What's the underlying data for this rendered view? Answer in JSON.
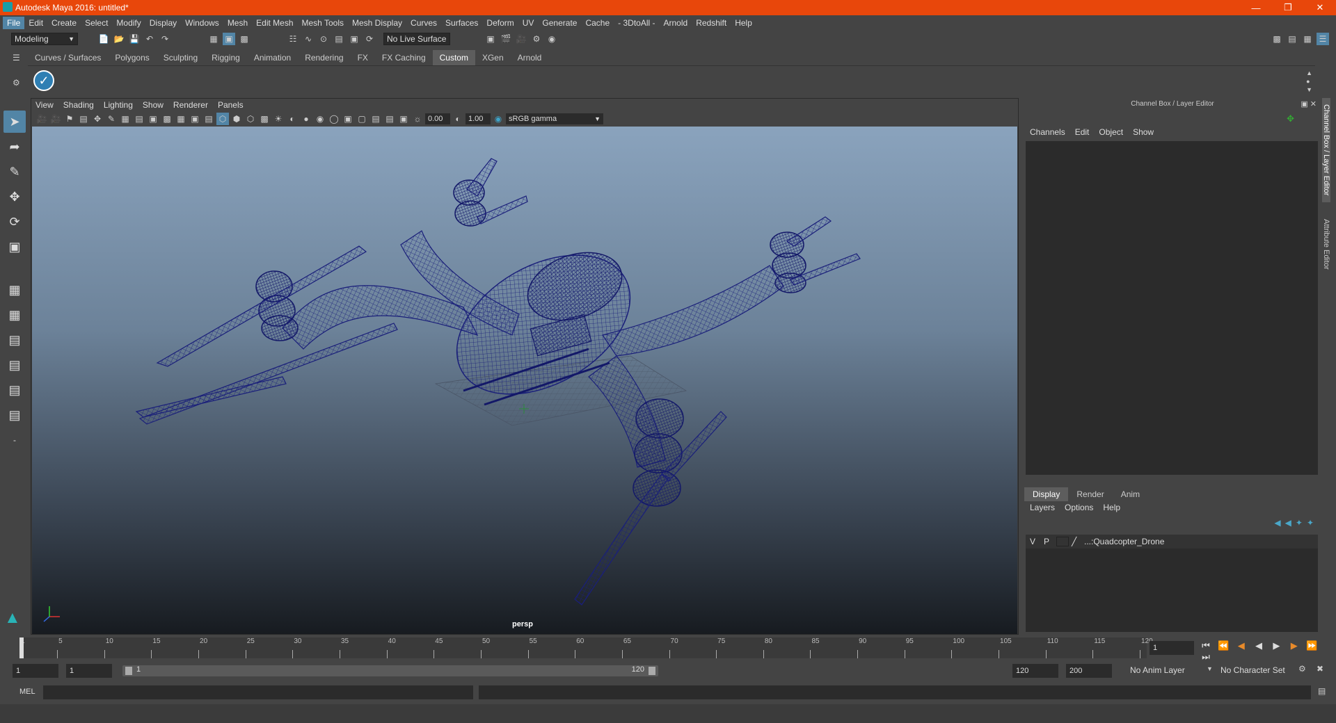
{
  "window": {
    "title": "Autodesk Maya 2016: untitled*"
  },
  "menubar": {
    "items": [
      "File",
      "Edit",
      "Create",
      "Select",
      "Modify",
      "Display",
      "Windows",
      "Mesh",
      "Edit Mesh",
      "Mesh Tools",
      "Mesh Display",
      "Curves",
      "Surfaces",
      "Deform",
      "UV",
      "Generate",
      "Cache",
      "- 3DtoAll -",
      "Arnold",
      "Redshift",
      "Help"
    ]
  },
  "statusline": {
    "menuset": "Modeling",
    "live_surface": "No Live Surface"
  },
  "shelf": {
    "tabs": [
      "Curves / Surfaces",
      "Polygons",
      "Sculpting",
      "Rigging",
      "Animation",
      "Rendering",
      "FX",
      "FX Caching",
      "Custom",
      "XGen",
      "Arnold"
    ],
    "active_tab": "Custom"
  },
  "viewport": {
    "menu": [
      "View",
      "Shading",
      "Lighting",
      "Show",
      "Renderer",
      "Panels"
    ],
    "exposure": "0.00",
    "gamma": "1.00",
    "color_space": "sRGB gamma",
    "camera_label": "persp"
  },
  "channel_box": {
    "title": "Channel Box / Layer Editor",
    "menu": [
      "Channels",
      "Edit",
      "Object",
      "Show"
    ],
    "layer_tabs": [
      "Display",
      "Render",
      "Anim"
    ],
    "active_layer_tab": "Display",
    "layer_menu": [
      "Layers",
      "Options",
      "Help"
    ],
    "layers": [
      {
        "v": "V",
        "p": "P",
        "name": "...:Quadcopter_Drone"
      }
    ]
  },
  "side_tabs": [
    "Channel Box / Layer Editor",
    "Attribute Editor"
  ],
  "timeslider": {
    "ticks": [
      "1",
      "5",
      "10",
      "15",
      "20",
      "25",
      "30",
      "35",
      "40",
      "45",
      "50",
      "55",
      "60",
      "65",
      "70",
      "75",
      "80",
      "85",
      "90",
      "95",
      "100",
      "105",
      "110",
      "115",
      "120"
    ],
    "current_frame": "1"
  },
  "range": {
    "start": "1",
    "playback_start": "1",
    "slider_start": "1",
    "slider_end": "120",
    "playback_end": "120",
    "end": "200",
    "anim_layer": "No Anim Layer",
    "character_set": "No Character Set"
  },
  "cmdline": {
    "label": "MEL"
  }
}
